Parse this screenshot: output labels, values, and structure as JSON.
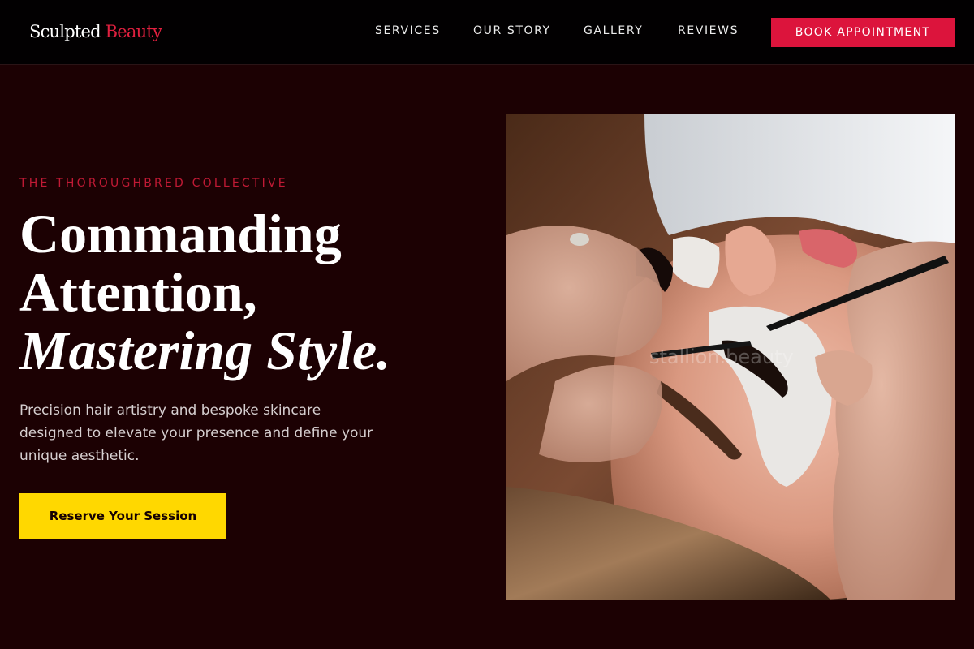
{
  "brand": {
    "name_primary": "Sculpted",
    "name_accent": "Beauty",
    "accent_color": "#dc143c"
  },
  "nav": {
    "items": [
      {
        "label": "SERVICES"
      },
      {
        "label": "OUR STORY"
      },
      {
        "label": "GALLERY"
      },
      {
        "label": "REVIEWS"
      }
    ],
    "cta_label": "BOOK APPOINTMENT"
  },
  "hero": {
    "eyebrow": "THE THOROUGHBRED COLLECTIVE",
    "headline_line1": "Commanding",
    "headline_line2": "Attention,",
    "headline_line3": "Mastering Style.",
    "subtitle": "Precision hair artistry and bespoke skincare designed to elevate your presence and define your unique aesthetic.",
    "cta_label": "Reserve Your Session",
    "cta_color": "#ffd800",
    "background_color": "#1c0103"
  },
  "photo": {
    "subject": "eyelash-extension-application",
    "watermark": "stallion.beauty"
  }
}
